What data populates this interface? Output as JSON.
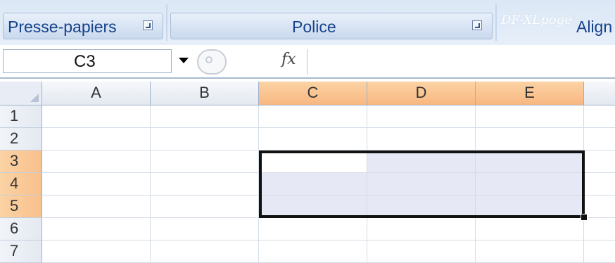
{
  "ribbon": {
    "clipboard_label": "Presse-papiers",
    "font_label": "Police",
    "watermark": "DF-XLpoge",
    "alignment_label": "Align"
  },
  "formula_bar": {
    "name_box": "C3",
    "fx_label": "fx",
    "formula": ""
  },
  "grid": {
    "columns": [
      "A",
      "B",
      "C",
      "D",
      "E"
    ],
    "rows": [
      "1",
      "2",
      "3",
      "4",
      "5",
      "6",
      "7"
    ],
    "selected_range": "C3:E5",
    "active_cell": "C3",
    "selected_columns": [
      "C",
      "D",
      "E"
    ],
    "selected_rows": [
      "3",
      "4",
      "5"
    ],
    "colors": {
      "selected_header": "#f8b781",
      "selection_fill": "#e6e8f6",
      "selection_border": "#111111"
    }
  }
}
